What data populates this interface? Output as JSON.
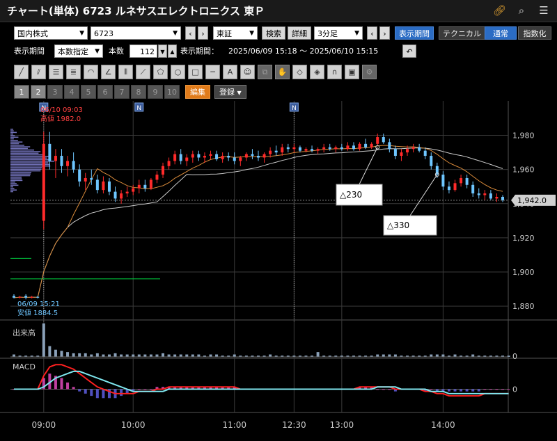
{
  "window": {
    "title": "チャート(単体) 6723 ルネサスエレクトロニクス 東Ｐ",
    "icons": [
      "link-icon",
      "search-icon",
      "menu-icon"
    ]
  },
  "toolbar1": {
    "market_select": "国内株式",
    "code_input": "6723",
    "exchange_select": "東証",
    "search_label": "検索",
    "detail_label": "詳細",
    "interval_select": "3分足",
    "period_label": "表示期間",
    "technical_label": "テクニカル",
    "normal_label": "通常",
    "index_label": "指数化"
  },
  "toolbar2": {
    "period_label": "表示期間",
    "period_mode_select": "本数指定",
    "count_label": "本数",
    "count_value": "112",
    "range_label": "表示期間：",
    "range_value": "2025/06/09 15:18 〜 2025/06/10 15:15"
  },
  "pagetabs": {
    "tabs": [
      "1",
      "2",
      "3",
      "4",
      "5",
      "6",
      "7",
      "8",
      "9",
      "10"
    ],
    "edit_label": "編集",
    "register_label": "登録"
  },
  "colors": {
    "up": "#ff2a2a",
    "down": "#6ec6ff",
    "ma_short": "#d98a3a",
    "ma_long": "#cccccc",
    "macd": "#ff2020",
    "signal": "#7fe8f0",
    "hist_pos": "#c040a0",
    "hist_neg": "#5050c0",
    "grid": "#3a3a3a",
    "price_tag": "#d0d0d0"
  },
  "chart_data": {
    "type": "candlestick",
    "y_ticks": [
      "1,980",
      "1,960",
      "1,940",
      "1,920",
      "1,900",
      "1,880"
    ],
    "ylim": [
      1876,
      1990
    ],
    "x_ticks": [
      "09:00",
      "10:00",
      "11:00",
      "12:30",
      "13:00",
      "14:00"
    ],
    "current_price": "1,942.0",
    "high_annotation": {
      "time": "06/10 09:03",
      "label": "高値 1982.0"
    },
    "low_annotation": {
      "time": "06/09 15:21",
      "label": "安値 1884.5"
    },
    "markers": [
      "N",
      "N",
      "N"
    ],
    "callouts": [
      "△230",
      "△330"
    ],
    "volume_label": "出来高",
    "volume_zero": "0",
    "macd_label": "MACD",
    "macd_zero": "0",
    "candles": [
      [
        1886,
        1887,
        1884.5,
        1885
      ],
      [
        1885,
        1886,
        1884.5,
        1885.5
      ],
      [
        1886,
        1887,
        1884,
        1885
      ],
      [
        1885,
        1886,
        1884.5,
        1885.5
      ],
      [
        1885.5,
        1886,
        1884.5,
        1885
      ],
      [
        1930,
        1982,
        1925,
        1975
      ],
      [
        1975,
        1982,
        1960,
        1965
      ],
      [
        1965,
        1972,
        1955,
        1968
      ],
      [
        1968,
        1972,
        1958,
        1962
      ],
      [
        1962,
        1968,
        1956,
        1965
      ],
      [
        1965,
        1970,
        1958,
        1960
      ],
      [
        1960,
        1963,
        1950,
        1953
      ],
      [
        1953,
        1958,
        1948,
        1955
      ],
      [
        1955,
        1960,
        1951,
        1954
      ],
      [
        1954,
        1957,
        1946,
        1948
      ],
      [
        1948,
        1956,
        1946,
        1953
      ],
      [
        1953,
        1955,
        1945,
        1947
      ],
      [
        1947,
        1950,
        1941,
        1943
      ],
      [
        1943,
        1948,
        1940,
        1946
      ],
      [
        1946,
        1950,
        1944,
        1947
      ],
      [
        1947,
        1951,
        1945,
        1949
      ],
      [
        1949,
        1954,
        1946,
        1951
      ],
      [
        1951,
        1954,
        1947,
        1949
      ],
      [
        1949,
        1955,
        1948,
        1954
      ],
      [
        1954,
        1959,
        1952,
        1957
      ],
      [
        1957,
        1964,
        1955,
        1962
      ],
      [
        1962,
        1967,
        1960,
        1965
      ],
      [
        1965,
        1971,
        1963,
        1969
      ],
      [
        1969,
        1972,
        1963,
        1965
      ],
      [
        1965,
        1969,
        1962,
        1967
      ],
      [
        1967,
        1971,
        1964,
        1969
      ],
      [
        1969,
        1971,
        1965,
        1967
      ],
      [
        1967,
        1970,
        1964,
        1968
      ],
      [
        1968,
        1971,
        1966,
        1969
      ],
      [
        1969,
        1971,
        1965,
        1966
      ],
      [
        1966,
        1970,
        1964,
        1968
      ],
      [
        1968,
        1970,
        1965,
        1967
      ],
      [
        1967,
        1970,
        1963,
        1965
      ],
      [
        1965,
        1968,
        1962,
        1967
      ],
      [
        1967,
        1970,
        1965,
        1969
      ],
      [
        1969,
        1972,
        1966,
        1968
      ],
      [
        1968,
        1971,
        1965,
        1967
      ],
      [
        1967,
        1970,
        1964,
        1969
      ],
      [
        1969,
        1973,
        1967,
        1971
      ],
      [
        1971,
        1974,
        1968,
        1970
      ],
      [
        1970,
        1975,
        1968,
        1973
      ],
      [
        1973,
        1975,
        1970,
        1972
      ],
      [
        1972,
        1975,
        1970,
        1973
      ],
      [
        1973,
        1974,
        1970,
        1971
      ],
      [
        1971,
        1973,
        1970,
        1972
      ],
      [
        1972,
        1974,
        1970,
        1971
      ],
      [
        1971,
        1973,
        1969,
        1972
      ],
      [
        1972,
        1975,
        1970,
        1973
      ],
      [
        1973,
        1975,
        1971,
        1972
      ],
      [
        1972,
        1974,
        1970,
        1973
      ],
      [
        1973,
        1975,
        1971,
        1972
      ],
      [
        1972,
        1976,
        1971,
        1974
      ],
      [
        1974,
        1976,
        1971,
        1972
      ],
      [
        1972,
        1976,
        1971,
        1975
      ],
      [
        1975,
        1978,
        1972,
        1973
      ],
      [
        1973,
        1976,
        1972,
        1975
      ],
      [
        1975,
        1981,
        1974,
        1979
      ],
      [
        1979,
        1981,
        1975,
        1976
      ],
      [
        1976,
        1978,
        1970,
        1972
      ],
      [
        1972,
        1974,
        1966,
        1968
      ],
      [
        1968,
        1972,
        1965,
        1970
      ],
      [
        1970,
        1974,
        1968,
        1972
      ],
      [
        1972,
        1975,
        1970,
        1973
      ],
      [
        1973,
        1975,
        1970,
        1971
      ],
      [
        1971,
        1973,
        1966,
        1968
      ],
      [
        1968,
        1970,
        1960,
        1962
      ],
      [
        1962,
        1964,
        1955,
        1957
      ],
      [
        1957,
        1959,
        1948,
        1950
      ],
      [
        1950,
        1953,
        1946,
        1948
      ],
      [
        1948,
        1954,
        1947,
        1952
      ],
      [
        1952,
        1957,
        1950,
        1955
      ],
      [
        1955,
        1957,
        1949,
        1951
      ],
      [
        1951,
        1953,
        1944,
        1946
      ],
      [
        1946,
        1949,
        1943,
        1945
      ],
      [
        1945,
        1948,
        1942,
        1946
      ],
      [
        1946,
        1948,
        1942,
        1943
      ],
      [
        1943,
        1946,
        1941,
        1944
      ],
      [
        1944,
        1945,
        1941,
        1942
      ]
    ],
    "volume": [
      2,
      1,
      1,
      1,
      1,
      28,
      9,
      6,
      5,
      4,
      3,
      3,
      3,
      2,
      3,
      2,
      2,
      3,
      2,
      2,
      2,
      2,
      2,
      2,
      2,
      3,
      2,
      2,
      2,
      2,
      2,
      2,
      1,
      2,
      2,
      1,
      1,
      2,
      1,
      1,
      1,
      1,
      1,
      2,
      1,
      1,
      1,
      1,
      1,
      1,
      1,
      4,
      1,
      1,
      1,
      1,
      1,
      1,
      1,
      1,
      1,
      2,
      2,
      2,
      2,
      1,
      1,
      1,
      1,
      1,
      2,
      2,
      2,
      1,
      2,
      1,
      1,
      2,
      1,
      1,
      1,
      1,
      1,
      1
    ],
    "macd": [
      0,
      0,
      0,
      0,
      0,
      6,
      10,
      11,
      11,
      10,
      9,
      7,
      5,
      3,
      1,
      0,
      -1,
      -2,
      -2,
      -2,
      -2,
      -1,
      -1,
      -1,
      0,
      0,
      1,
      1,
      1,
      1,
      1,
      1,
      1,
      1,
      1,
      1,
      1,
      1,
      0,
      0,
      0,
      0,
      0,
      0,
      0,
      0,
      0,
      0,
      0,
      0,
      0,
      0,
      0,
      0,
      0,
      0,
      0,
      0,
      1,
      1,
      1,
      1,
      1,
      1,
      0,
      0,
      0,
      0,
      0,
      -1,
      -1,
      -2,
      -2,
      -3,
      -3,
      -3,
      -3,
      -3,
      -3,
      -2,
      -2,
      -2,
      -2,
      -2
    ],
    "signal": [
      0,
      0,
      0,
      0,
      0,
      1,
      3,
      5,
      6,
      7,
      8,
      8,
      7,
      6,
      5,
      4,
      3,
      2,
      1,
      0,
      -1,
      -1,
      -1,
      -1,
      -1,
      -1,
      0,
      0,
      0,
      0,
      0,
      0,
      0,
      0,
      0,
      0,
      0,
      0,
      0,
      0,
      0,
      0,
      0,
      0,
      0,
      0,
      0,
      0,
      0,
      0,
      0,
      0,
      0,
      0,
      0,
      0,
      0,
      0,
      0,
      0,
      0,
      1,
      1,
      1,
      1,
      0,
      0,
      0,
      0,
      0,
      -1,
      -1,
      -1,
      -2,
      -2,
      -2,
      -2,
      -2,
      -2,
      -2,
      -2,
      -2,
      -2,
      -2
    ]
  }
}
